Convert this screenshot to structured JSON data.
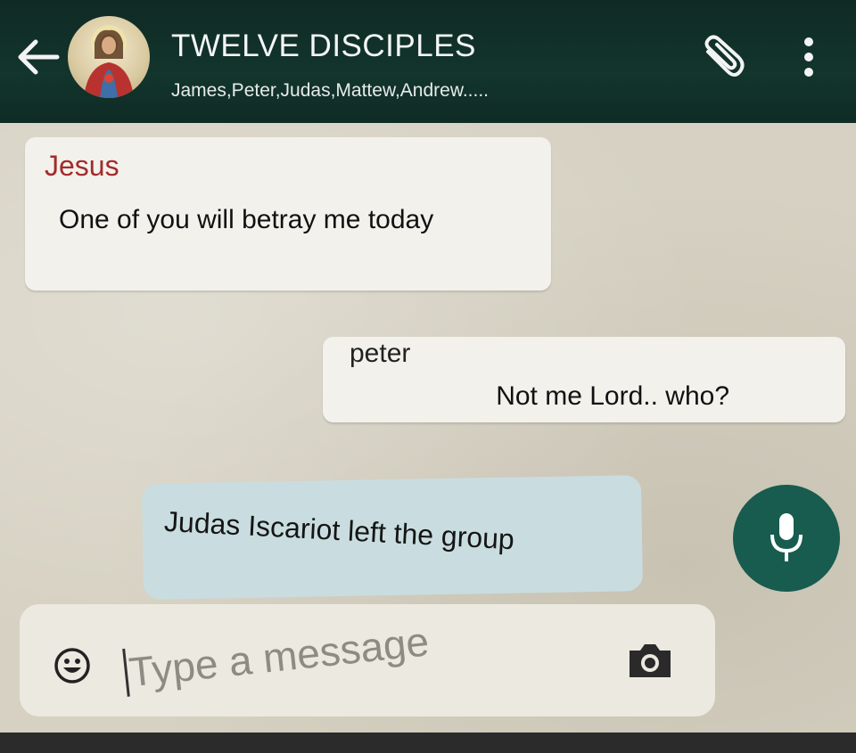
{
  "header": {
    "title": "TWELVE DISCIPLES",
    "subtitle": "James,Peter,Judas,Mattew,Andrew.....",
    "back_icon": "arrow-left-icon",
    "attach_icon": "paperclip-icon",
    "menu_icon": "vertical-dots-icon"
  },
  "messages": [
    {
      "sender": "Jesus",
      "text": "One of you will betray me today",
      "direction": "incoming"
    },
    {
      "sender": "peter",
      "text": "Not me Lord.. who?",
      "direction": "outgoing"
    }
  ],
  "system_notice": {
    "text": "Judas Iscariot left the group"
  },
  "composer": {
    "placeholder": "Type a message",
    "emoji_icon": "smiley-icon",
    "camera_icon": "camera-icon",
    "mic_icon": "microphone-icon"
  },
  "colors": {
    "header_bg": "#12352c",
    "sender_jesus": "#a32b2b",
    "mic_button": "#175c4f",
    "notice_bg": "#c9dde0"
  }
}
